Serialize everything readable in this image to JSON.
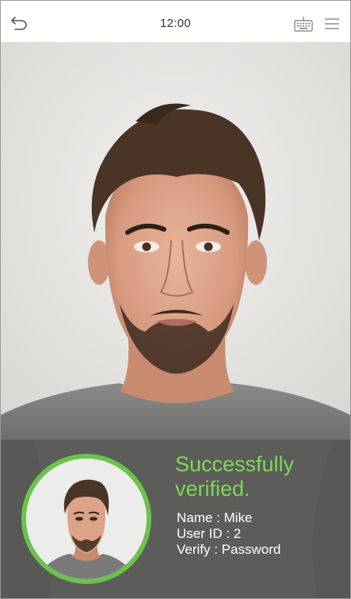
{
  "status_bar": {
    "time": "12:00",
    "back_icon": "back-arrow-icon",
    "keyboard_icon": "keyboard-icon",
    "menu_icon": "menu-icon"
  },
  "camera": {
    "subject": "face-capture-feed"
  },
  "verification": {
    "title": "Successfully verified.",
    "name_line": "Name : Mike",
    "user_id_line": "User ID : 2",
    "verify_line": "Verify : Password",
    "accent_color": "#6cc24a",
    "title_color": "#7ed957",
    "panel_color": "#5a5a5a"
  }
}
